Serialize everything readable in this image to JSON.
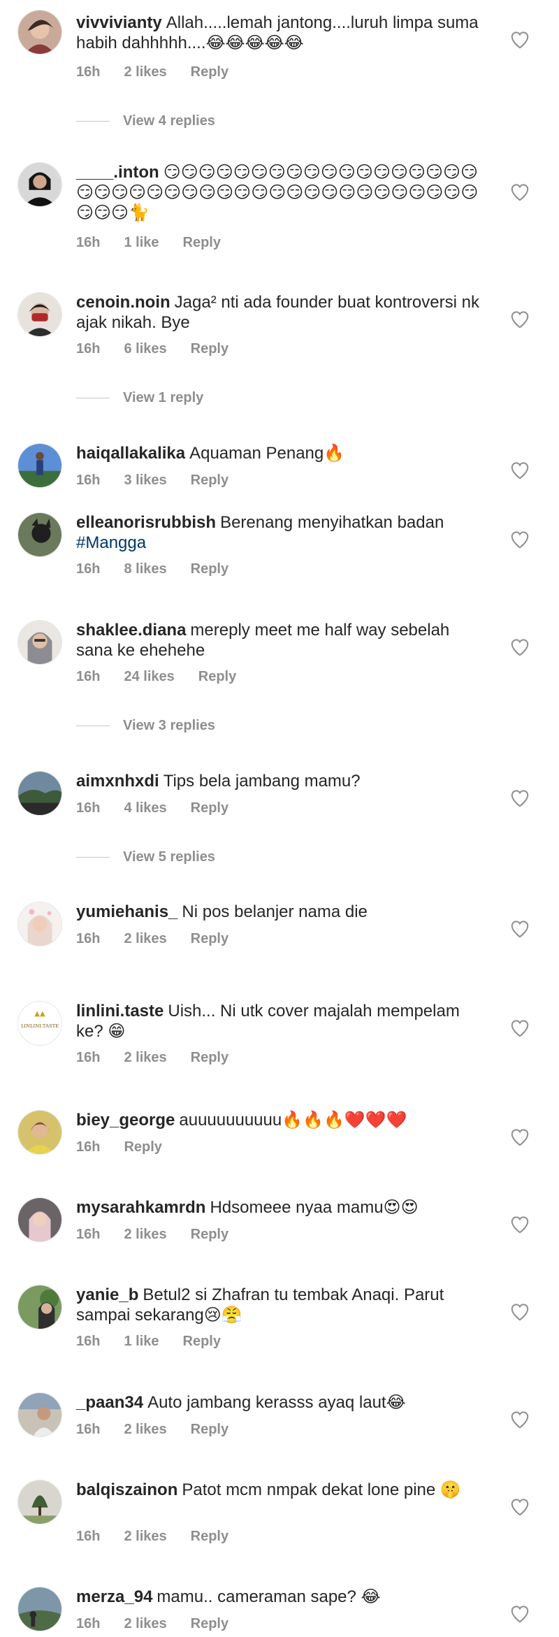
{
  "comments": [
    {
      "user": "vivvivianty",
      "text": "Allah.....lemah jantong....luruh limpa suma habih dahhhhh....😂😂😂😂😂",
      "time": "16h",
      "likes": "2 likes",
      "reply": "Reply",
      "view_replies": "View 4 replies"
    },
    {
      "user": "____.inton",
      "text": "😏😏😏😏😏😏😏😏😏😏😏😏😏😏😏😏😏😏😏😏😏😏😏😏😏😏😏😏😏😏😏😏😏😏😏😏😏😏😏😏😏😏😏😏🐈",
      "time": "16h",
      "likes": "1 like",
      "reply": "Reply"
    },
    {
      "user": "cenoin.noin",
      "text": "Jaga² nti ada founder buat kontroversi nk ajak nikah. Bye",
      "time": "16h",
      "likes": "6 likes",
      "reply": "Reply",
      "view_replies": "View 1 reply"
    },
    {
      "user": "haiqallakalika",
      "text": "Aquaman Penang🔥",
      "time": "16h",
      "likes": "3 likes",
      "reply": "Reply"
    },
    {
      "user": "elleanorisrubbish",
      "text": "Berenang menyihatkan badan",
      "hashtag": "#Mangga",
      "time": "16h",
      "likes": "8 likes",
      "reply": "Reply"
    },
    {
      "user": "shaklee.diana",
      "text": "mereply meet me half way sebelah sana ke ehehehe",
      "time": "16h",
      "likes": "24 likes",
      "reply": "Reply",
      "view_replies": "View 3 replies"
    },
    {
      "user": "aimxnhxdi",
      "text": "Tips bela jambang mamu?",
      "time": "16h",
      "likes": "4 likes",
      "reply": "Reply",
      "view_replies": "View 5 replies"
    },
    {
      "user": "yumiehanis_",
      "text": "Ni pos belanjer nama die",
      "time": "16h",
      "likes": "2 likes",
      "reply": "Reply"
    },
    {
      "user": "linlini.taste",
      "text": "Uish... Ni utk cover majalah mempelam ke? 😁",
      "time": "16h",
      "likes": "2 likes",
      "reply": "Reply",
      "logo_text": "LINLINI.TASTE"
    },
    {
      "user": "biey_george",
      "text": "auuuuuuuuuu🔥🔥🔥❤️❤️❤️",
      "time": "16h",
      "reply": "Reply"
    },
    {
      "user": "mysarahkamrdn",
      "text": "Hdsomeee nyaa mamu😍😍",
      "time": "16h",
      "likes": "2 likes",
      "reply": "Reply"
    },
    {
      "user": "yanie_b",
      "text": "Betul2 si Zhafran tu tembak Anaqi. Parut sampai sekarang😢😤",
      "time": "16h",
      "likes": "1 like",
      "reply": "Reply"
    },
    {
      "user": "_paan34",
      "text": "Auto jambang kerasss ayaq laut😂",
      "time": "16h",
      "likes": "2 likes",
      "reply": "Reply"
    },
    {
      "user": "balqiszainon",
      "text": "Patot mcm nmpak dekat lone pine 🤫",
      "time": "16h",
      "likes": "2 likes",
      "reply": "Reply"
    },
    {
      "user": "merza_94",
      "text": "mamu.. cameraman sape? 😂",
      "time": "16h",
      "likes": "2 likes",
      "reply": "Reply"
    }
  ],
  "colors": {
    "primary_text": "#262626",
    "secondary_text": "#8e8e8e",
    "hashtag": "#00376b"
  },
  "icons": {
    "like": "heart-outline-icon"
  }
}
